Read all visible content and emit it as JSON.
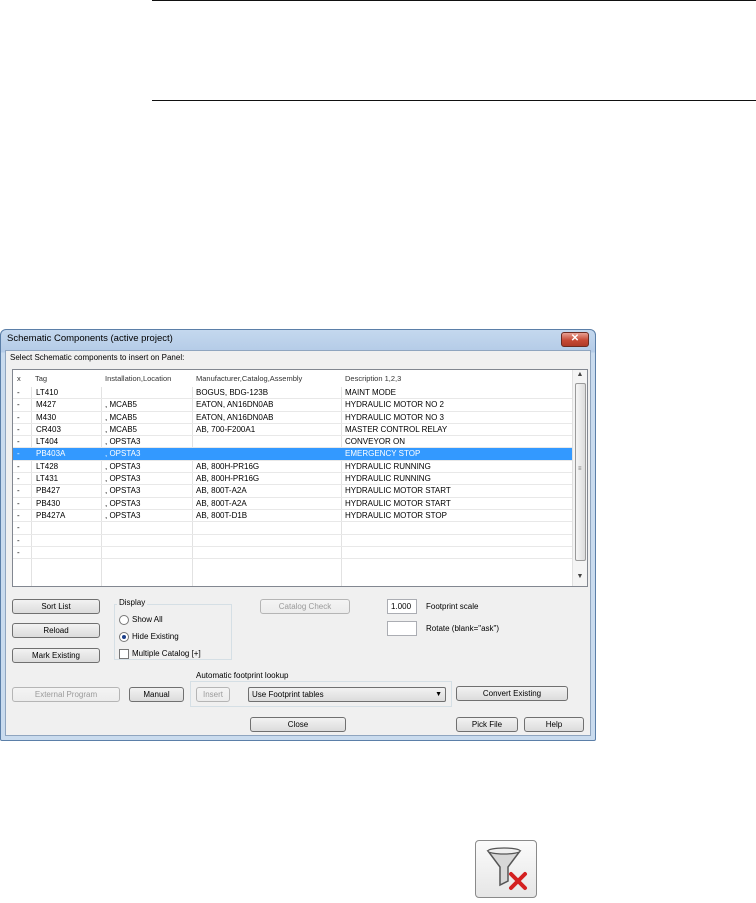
{
  "dialog": {
    "title": "Schematic Components (active project)",
    "close_glyph": "✕",
    "prompt": "Select Schematic components to insert on Panel:"
  },
  "list": {
    "headers": [
      "x",
      "Tag",
      "Installation,Location",
      "Manufacturer,Catalog,Assembly",
      "Description 1,2,3"
    ],
    "rows": [
      {
        "x": "-",
        "tag": "LT410",
        "loc": "",
        "mfr": "BOGUS, BDG-123B",
        "desc": "MAINT MODE"
      },
      {
        "x": "-",
        "tag": "M427",
        "loc": ", MCAB5",
        "mfr": "EATON, AN16DN0AB",
        "desc": "HYDRAULIC MOTOR NO 2"
      },
      {
        "x": "-",
        "tag": "M430",
        "loc": ", MCAB5",
        "mfr": "EATON, AN16DN0AB",
        "desc": "HYDRAULIC MOTOR NO 3"
      },
      {
        "x": "-",
        "tag": "CR403",
        "loc": ", MCAB5",
        "mfr": "AB, 700-F200A1",
        "desc": "MASTER CONTROL RELAY"
      },
      {
        "x": "-",
        "tag": "LT404",
        "loc": ", OPSTA3",
        "mfr": "",
        "desc": "CONVEYOR ON"
      },
      {
        "x": "-",
        "tag": "PB403A",
        "loc": ", OPSTA3",
        "mfr": "",
        "desc": "EMERGENCY STOP",
        "selected": true
      },
      {
        "x": "-",
        "tag": "LT428",
        "loc": ", OPSTA3",
        "mfr": "AB, 800H-PR16G",
        "desc": "HYDRAULIC RUNNING"
      },
      {
        "x": "-",
        "tag": "LT431",
        "loc": ", OPSTA3",
        "mfr": "AB, 800H-PR16G",
        "desc": "HYDRAULIC RUNNING"
      },
      {
        "x": "-",
        "tag": "PB427",
        "loc": ", OPSTA3",
        "mfr": "AB, 800T-A2A",
        "desc": "HYDRAULIC MOTOR START"
      },
      {
        "x": "-",
        "tag": "PB430",
        "loc": ", OPSTA3",
        "mfr": "AB, 800T-A2A",
        "desc": "HYDRAULIC MOTOR START"
      },
      {
        "x": "-",
        "tag": "PB427A",
        "loc": ", OPSTA3",
        "mfr": "AB, 800T-D1B",
        "desc": "HYDRAULIC MOTOR STOP"
      },
      {
        "x": "-",
        "tag": "",
        "loc": "",
        "mfr": "",
        "desc": ""
      },
      {
        "x": "-",
        "tag": "",
        "loc": "",
        "mfr": "",
        "desc": ""
      },
      {
        "x": "-",
        "tag": "",
        "loc": "",
        "mfr": "",
        "desc": ""
      }
    ],
    "scroll_up": "▲",
    "scroll_down": "▼"
  },
  "buttons": {
    "sort_list": "Sort List",
    "reload": "Reload",
    "mark_existing": "Mark Existing",
    "catalog_check": "Catalog Check",
    "external_program": "External Program",
    "manual": "Manual",
    "insert": "Insert",
    "convert_existing": "Convert Existing",
    "close": "Close",
    "pick_file": "Pick File",
    "help": "Help"
  },
  "display": {
    "group_label": "Display",
    "show_all": "Show All",
    "hide_existing": "Hide Existing",
    "multiple_catalog": "Multiple Catalog [+]"
  },
  "footprint": {
    "scale_value": "1.000",
    "scale_label": "Footprint scale",
    "rotate_value": "",
    "rotate_label": "Rotate (blank=\"ask\")",
    "lookup_label": "Automatic footprint lookup",
    "lookup_selected": "Use Footprint tables"
  },
  "colors": {
    "selection": "#3399ff",
    "titlebar": "#c4d8ee",
    "close_button": "#c74a36"
  },
  "tool_icon": "funnel-with-red-x-icon"
}
